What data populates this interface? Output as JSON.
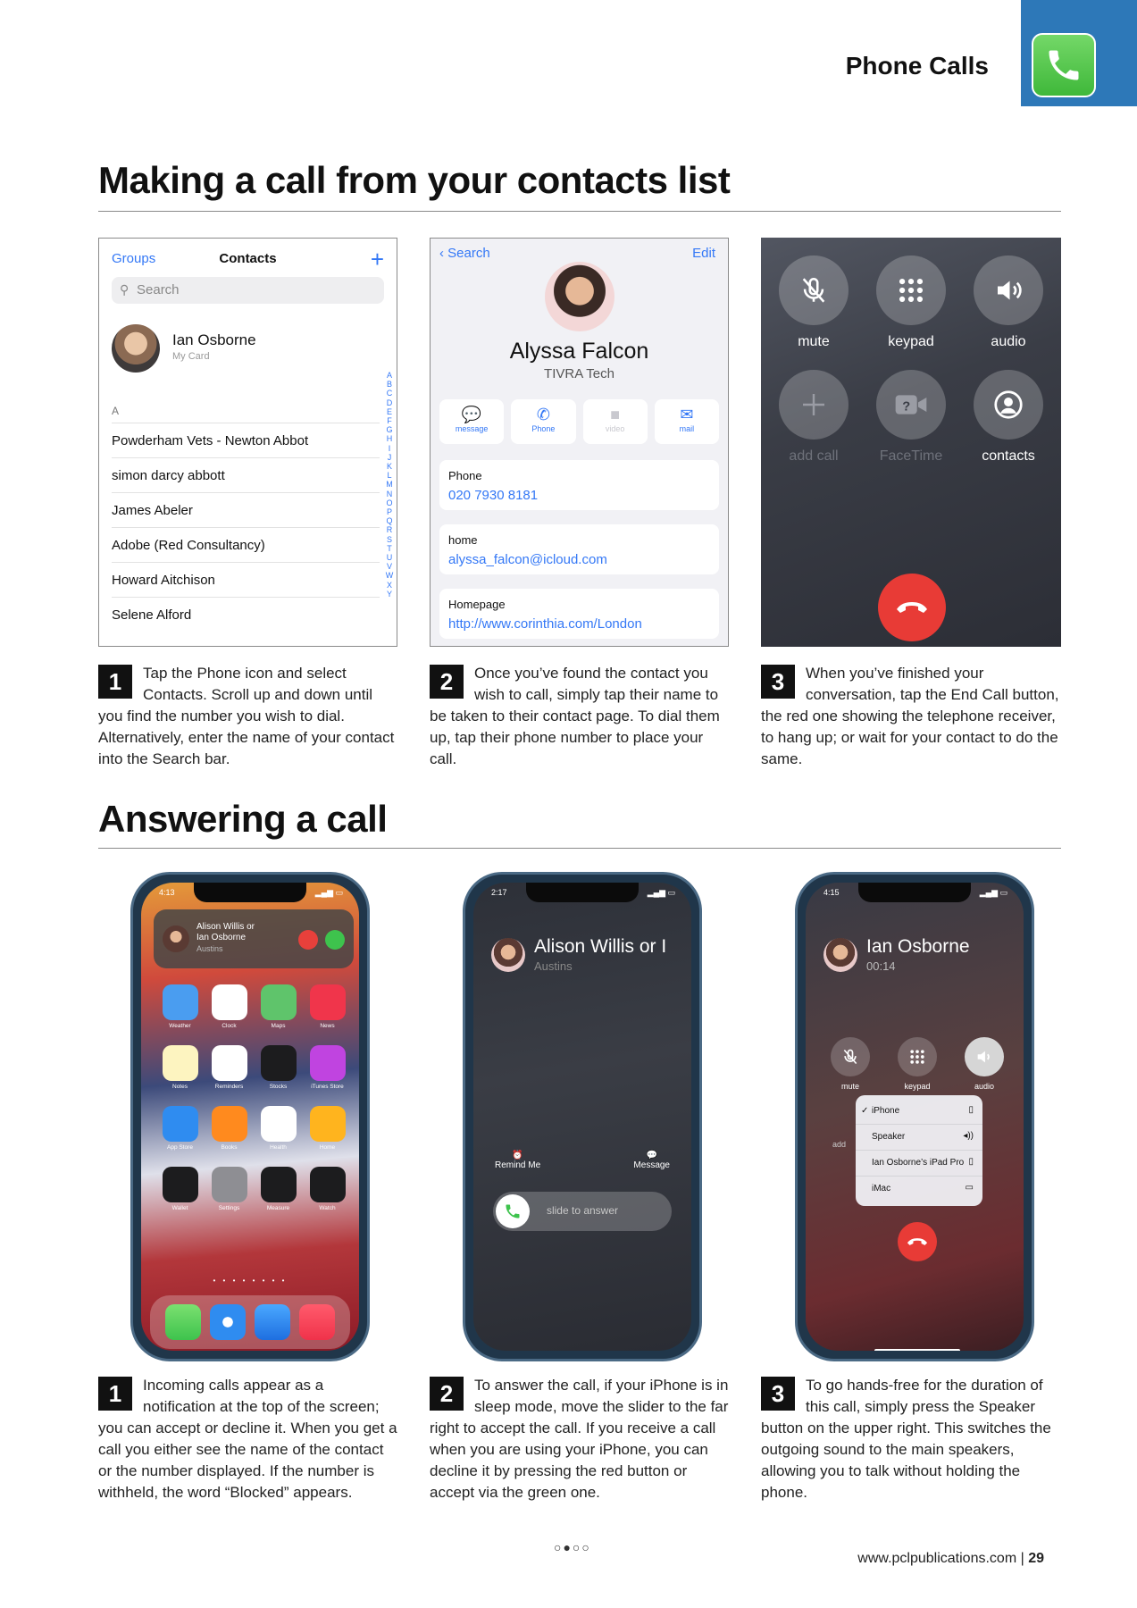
{
  "header": {
    "title": "Phone Calls"
  },
  "section1": {
    "title": "Making a call from your contacts list"
  },
  "section2": {
    "title": "Answering a call"
  },
  "contacts": {
    "groups": "Groups",
    "title": "Contacts",
    "add": "+",
    "search_placeholder": "Search",
    "my_name": "Ian Osborne",
    "my_card": "My Card",
    "section": "A",
    "rows": [
      "Powderham Vets - Newton Abbot",
      "simon darcy abbott",
      "James Abeler",
      "Adobe (Red Consultancy)",
      "Howard Aitchison",
      "Selene Alford"
    ],
    "alphabet": [
      "A",
      "B",
      "C",
      "D",
      "E",
      "F",
      "G",
      "H",
      "I",
      "J",
      "K",
      "L",
      "M",
      "N",
      "O",
      "P",
      "Q",
      "R",
      "S",
      "T",
      "U",
      "V",
      "W",
      "X",
      "Y"
    ]
  },
  "detail": {
    "back": "Search",
    "edit": "Edit",
    "name": "Alyssa Falcon",
    "company": "TIVRA Tech",
    "actions": [
      "message",
      "Phone",
      "video",
      "mail"
    ],
    "phone_label": "Phone",
    "phone_value": "020 7930 8181",
    "home_label": "home",
    "home_value": "alyssa_falcon@icloud.com",
    "homepage_label": "Homepage",
    "homepage_value": "http://www.corinthia.com/London"
  },
  "callscreen": {
    "buttons": [
      "mute",
      "keypad",
      "audio",
      "add call",
      "FaceTime",
      "contacts"
    ]
  },
  "steps_top": [
    {
      "num": "1",
      "text": "Tap the Phone icon and select Contacts. Scroll up and down until you find the number you wish to dial. Alternatively, enter the name of your contact into the Search bar."
    },
    {
      "num": "2",
      "text": "Once you’ve found the contact you wish to call, simply tap their name to be taken to their contact page. To dial them up, tap their phone number to place your call."
    },
    {
      "num": "3",
      "text": "When you’ve finished your conversation, tap the End Call button, the red one showing the telephone receiver, to hang up; or wait for your contact to do the same."
    }
  ],
  "phone1": {
    "time": "4:13",
    "notif_line1": "Alison Willis or",
    "notif_line2": "Ian Osborne",
    "notif_sub": "Austins",
    "apps": [
      "Weather",
      "Clock",
      "Maps",
      "News",
      "Notes",
      "Reminders",
      "Stocks",
      "iTunes Store",
      "App Store",
      "Books",
      "Health",
      "Home",
      "Wallet",
      "Settings",
      "Measure",
      "Watch"
    ],
    "dots": "• • • • • • • •"
  },
  "phone2": {
    "time": "2:17",
    "caller": "Alison Willis or I",
    "sub": "Austins",
    "remind": "Remind Me",
    "message": "Message",
    "slide": "slide to answer"
  },
  "phone3": {
    "time": "4:15",
    "caller": "Ian Osborne",
    "duration": "00:14",
    "btns": [
      "mute",
      "keypad",
      "audio"
    ],
    "add": "add",
    "menu": [
      "iPhone",
      "Speaker",
      "Ian Osborne’s iPad Pro",
      "iMac"
    ],
    "check": "✓"
  },
  "steps_bottom": [
    {
      "num": "1",
      "text": "Incoming calls appear as a notification at the top of the screen; you can accept or decline it. When you get a call you either see the name of the contact or the number displayed. If the number is withheld, the word “Blocked” appears."
    },
    {
      "num": "2",
      "text": "To answer the call, if your iPhone is in sleep mode, move the slider to the far right to accept the call. If you receive a call when you are using your iPhone, you can decline it by pressing the red button or accept via the green one."
    },
    {
      "num": "3",
      "text": "To go hands-free for the duration of this call, simply press the Speaker button on the upper right. This switches the outgoing sound to the main speakers, allowing you to talk without holding the phone."
    }
  ],
  "pager": "○●○○",
  "footer": {
    "url": "www.pclpublications.com",
    "sep": " | ",
    "page": "29"
  },
  "colors": {
    "accent_blue": "#2d78b8",
    "ios_blue": "#3478f6",
    "end_red": "#e83b36",
    "accept_green": "#3ec34d"
  }
}
